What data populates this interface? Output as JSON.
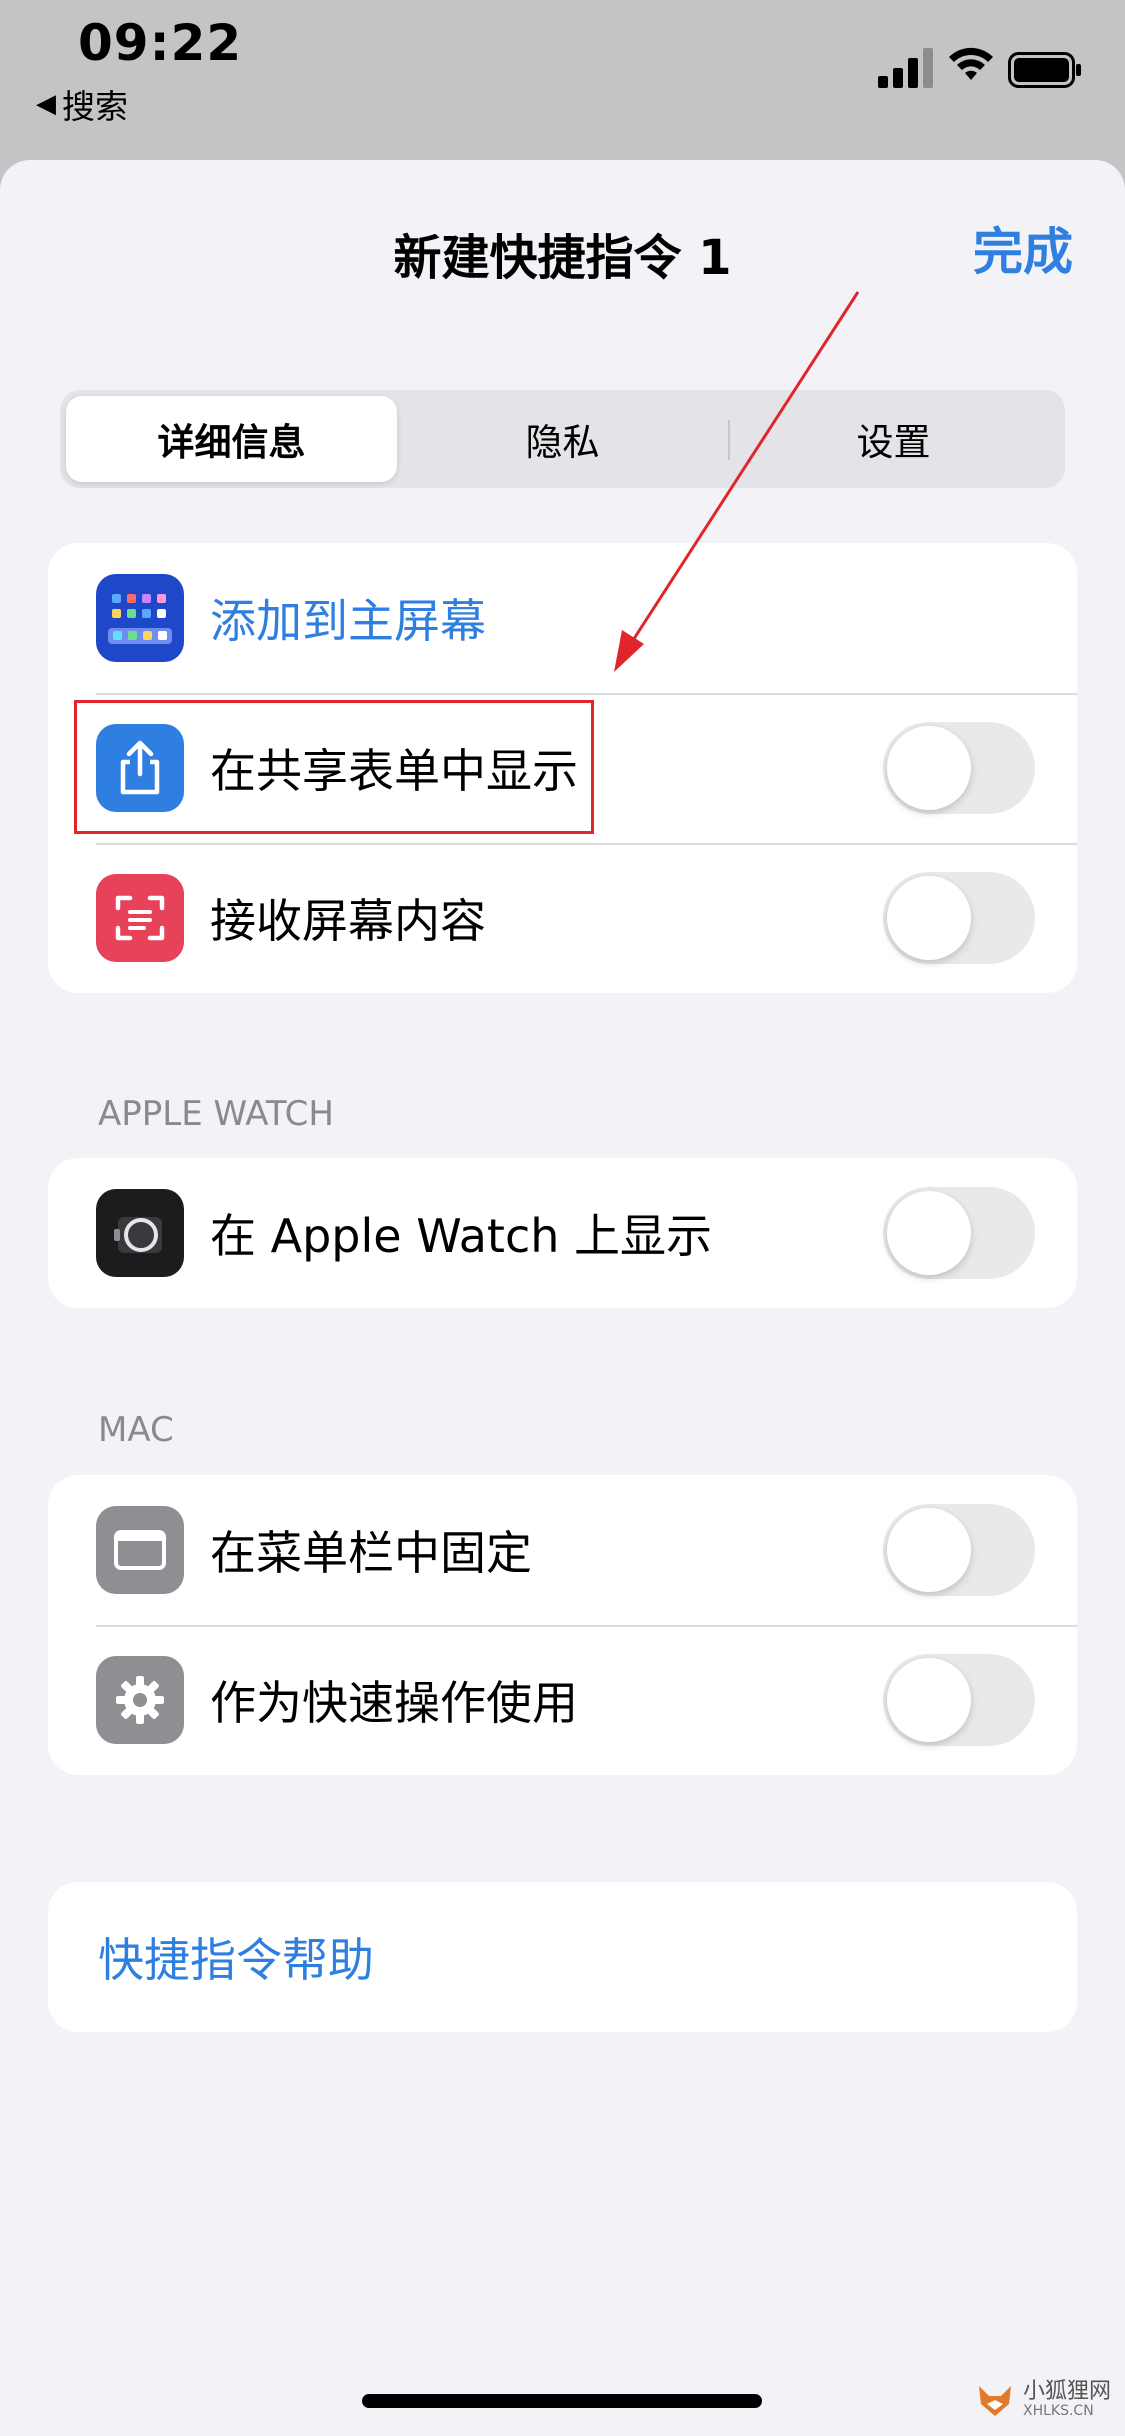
{
  "status_bar": {
    "time": "09:22",
    "back_label": "搜索"
  },
  "sheet": {
    "title": "新建快捷指令 1",
    "done_label": "完成"
  },
  "segmented": {
    "tabs": [
      {
        "label": "详细信息",
        "selected": true
      },
      {
        "label": "隐私",
        "selected": false
      },
      {
        "label": "设置",
        "selected": false
      }
    ]
  },
  "main_group": {
    "rows": [
      {
        "label": "添加到主屏幕",
        "icon": "home-screen-grid-icon",
        "icon_color": "#1f48c8"
      },
      {
        "label": "在共享表单中显示",
        "icon": "share-icon",
        "icon_color": "#2f7fe0",
        "toggle_on": false
      },
      {
        "label": "接收屏幕内容",
        "icon": "screen-capture-icon",
        "icon_color": "#e8415a",
        "toggle_on": false
      }
    ]
  },
  "apple_watch": {
    "header": "APPLE WATCH",
    "rows": [
      {
        "label": "在 Apple Watch 上显示",
        "icon": "watch-icon",
        "icon_color": "#1c1c1e",
        "toggle_on": false
      }
    ]
  },
  "mac": {
    "header": "MAC",
    "rows": [
      {
        "label": "在菜单栏中固定",
        "icon": "menubar-window-icon",
        "icon_color": "#8e8e93",
        "toggle_on": false
      },
      {
        "label": "作为快速操作使用",
        "icon": "gear-icon",
        "icon_color": "#8e8e93",
        "toggle_on": false
      }
    ]
  },
  "help": {
    "label": "快捷指令帮助"
  },
  "watermark": {
    "name": "小狐狸网",
    "domain": "XHLKS.CN"
  },
  "colors": {
    "accent": "#2f7fe0",
    "annotation_red": "#e0262b"
  }
}
